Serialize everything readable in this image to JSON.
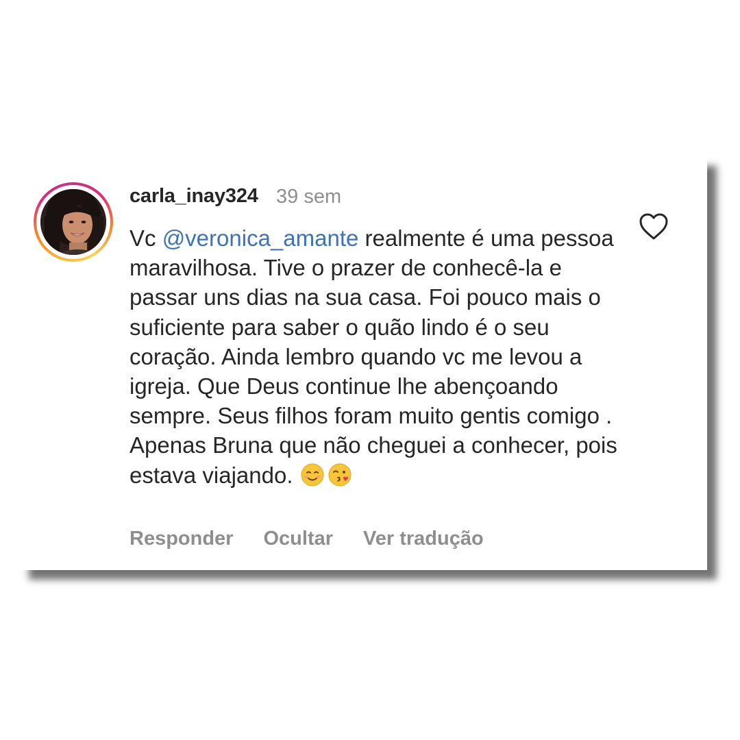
{
  "comment": {
    "username": "carla_inay324",
    "time": "39 sem",
    "prefix": "Vc ",
    "mention": "@veronica_amante",
    "body": " realmente é uma pessoa maravilhosa. Tive o prazer de conhecê-la e passar uns dias na sua casa. Foi pouco mais o suficiente para saber o quão lindo é o seu coração. Ainda lembro quando vc me levou a igreja. Que Deus continue lhe abençoando sempre. Seus filhos foram muito gentis comigo . Apenas Bruna que não cheguei a conhecer, pois estava viajando.",
    "emojis": [
      "smiling-face-icon",
      "kissing-face-icon"
    ]
  },
  "actions": {
    "reply": "Responder",
    "hide": "Ocultar",
    "translate": "Ver tradução"
  },
  "icons": {
    "like": "heart-outline-icon"
  },
  "colors": {
    "mention": "#3d73b6",
    "text": "#262626",
    "muted": "#8e8e8e"
  }
}
